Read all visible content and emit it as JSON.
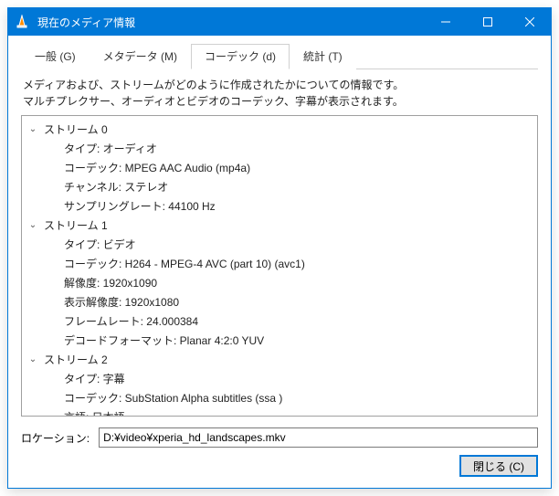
{
  "window": {
    "title": "現在のメディア情報"
  },
  "tabs": [
    {
      "label": "一般 (G)"
    },
    {
      "label": "メタデータ (M)"
    },
    {
      "label": "コーデック (d)"
    },
    {
      "label": "統計 (T)"
    }
  ],
  "active_tab": 2,
  "description": {
    "line1": "メディアおよび、ストリームがどのように作成されたかについての情報です。",
    "line2": "マルチプレクサー、オーディオとビデオのコーデック、字幕が表示されます。"
  },
  "streams": [
    {
      "header": "ストリーム 0",
      "props": [
        {
          "label": "タイプ",
          "value": "オーディオ"
        },
        {
          "label": "コーデック",
          "value": "MPEG AAC Audio (mp4a)"
        },
        {
          "label": "チャンネル",
          "value": "ステレオ"
        },
        {
          "label": "サンプリングレート",
          "value": "44100 Hz"
        }
      ]
    },
    {
      "header": "ストリーム 1",
      "props": [
        {
          "label": "タイプ",
          "value": "ビデオ"
        },
        {
          "label": "コーデック",
          "value": "H264 - MPEG-4 AVC (part 10) (avc1)"
        },
        {
          "label": "解像度",
          "value": "1920x1090"
        },
        {
          "label": "表示解像度",
          "value": "1920x1080"
        },
        {
          "label": "フレームレート",
          "value": "24.000384"
        },
        {
          "label": "デコードフォーマット",
          "value": "Planar 4:2:0 YUV"
        }
      ]
    },
    {
      "header": "ストリーム 2",
      "props": [
        {
          "label": "タイプ",
          "value": "字幕"
        },
        {
          "label": "コーデック",
          "value": "SubStation Alpha subtitles (ssa )"
        },
        {
          "label": "言語",
          "value": "日本語"
        }
      ]
    }
  ],
  "location": {
    "label": "ロケーション:",
    "value": "D:¥video¥xperia_hd_landscapes.mkv"
  },
  "buttons": {
    "close": "閉じる (C)"
  }
}
